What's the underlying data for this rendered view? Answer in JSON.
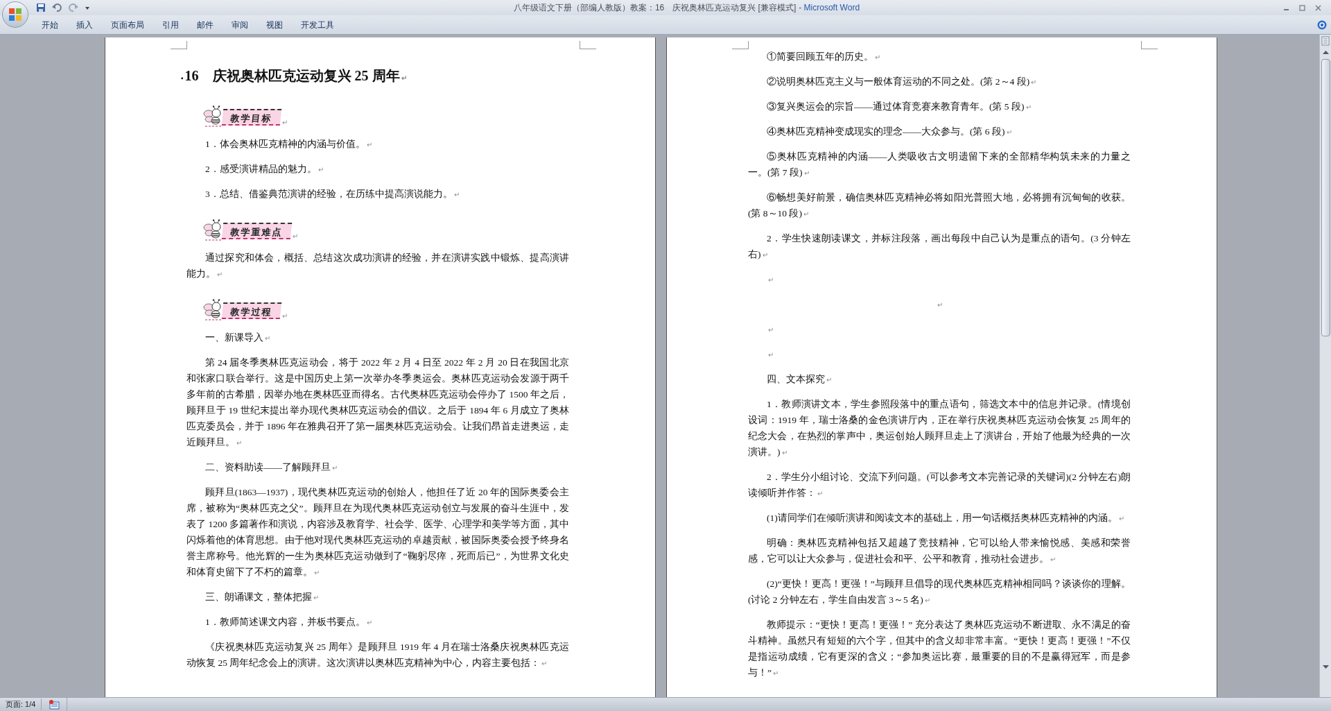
{
  "window": {
    "title": "八年级语文下册（部编人教版）教案：16　庆祝奥林匹克运动复兴 [兼容模式]",
    "app_name": "- Microsoft Word"
  },
  "ribbon_tabs": [
    {
      "label": "开始"
    },
    {
      "label": "插入"
    },
    {
      "label": "页面布局"
    },
    {
      "label": "引用"
    },
    {
      "label": "邮件"
    },
    {
      "label": "审阅"
    },
    {
      "label": "视图"
    },
    {
      "label": "开发工具"
    }
  ],
  "pages": [
    {
      "blocks": [
        {
          "kind": "title",
          "marker": "▪",
          "text": "16　庆祝奥林匹克运动复兴 25 周年",
          "mark": "↵"
        },
        {
          "kind": "badge",
          "text": "教学目标",
          "mark": "↵"
        },
        {
          "kind": "para",
          "text": "1．体会奥林匹克精神的内涵与价值。",
          "mark": "↵"
        },
        {
          "kind": "para",
          "text": "2．感受演讲精品的魅力。",
          "mark": "↵"
        },
        {
          "kind": "para",
          "text": "3．总结、借鉴典范演讲的经验，在历练中提高演说能力。",
          "mark": "↵"
        },
        {
          "kind": "badge",
          "text": "教学重难点",
          "mark": "↵"
        },
        {
          "kind": "para",
          "text": "通过探究和体会，概括、总结这次成功演讲的经验，并在演讲实践中锻炼、提高演讲能力。",
          "mark": "↵"
        },
        {
          "kind": "badge",
          "text": "教学过程",
          "mark": "↵"
        },
        {
          "kind": "para",
          "text": "一、新课导入",
          "mark": "↵"
        },
        {
          "kind": "para",
          "text": "第 24 届冬季奥林匹克运动会，将于 2022 年 2 月 4 日至 2022 年 2 月 20 日在我国北京和张家口联合举行。这是中国历史上第一次举办冬季奥运会。奥林匹克运动会发源于两千多年前的古希腊，因举办地在奥林匹亚而得名。古代奥林匹克运动会停办了 1500 年之后，顾拜旦于 19 世纪末提出举办现代奥林匹克运动会的倡议。之后于 1894 年 6 月成立了奥林匹克委员会，并于 1896 年在雅典召开了第一届奥林匹克运动会。让我们昂首走进奥运，走近顾拜旦。",
          "mark": "↵"
        },
        {
          "kind": "para",
          "text": "二、资料助读——了解顾拜旦",
          "mark": "↵"
        },
        {
          "kind": "para",
          "text": "顾拜旦(1863—1937)，现代奥林匹克运动的创始人，他担任了近 20 年的国际奥委会主席，被称为“奥林匹克之父”。顾拜旦在为现代奥林匹克运动创立与发展的奋斗生涯中，发表了 1200 多篇著作和演说，内容涉及教育学、社会学、医学、心理学和美学等方面，其中闪烁着他的体育思想。由于他对现代奥林匹克运动的卓越贡献，被国际奥委会授予终身名誉主席称号。他光辉的一生为奥林匹克运动做到了“鞠躬尽瘁，死而后已”，为世界文化史和体育史留下了不朽的篇章。",
          "mark": "↵"
        },
        {
          "kind": "para",
          "text": "三、朗诵课文，整体把握",
          "mark": "↵"
        },
        {
          "kind": "para",
          "text": "1．教师简述课文内容，并板书要点。",
          "mark": "↵"
        },
        {
          "kind": "para",
          "text": "《庆祝奥林匹克运动复兴 25 周年》是顾拜旦 1919 年 4 月在瑞士洛桑庆祝奥林匹克运动恢复 25 周年纪念会上的演讲。这次演讲以奥林匹克精神为中心，内容主要包括：",
          "mark": "↵"
        }
      ]
    },
    {
      "blocks": [
        {
          "kind": "para",
          "text": "①简要回顾五年的历史。",
          "mark": "↵"
        },
        {
          "kind": "para",
          "text": "②说明奥林匹克主义与一般体育运动的不同之处。(第 2～4 段)",
          "mark": "↵"
        },
        {
          "kind": "para",
          "text": "③复兴奥运会的宗旨——通过体育竞赛来教育青年。(第 5 段)",
          "mark": "↵"
        },
        {
          "kind": "para",
          "text": "④奥林匹克精神变成现实的理念——大众参与。(第 6 段)",
          "mark": "↵"
        },
        {
          "kind": "para",
          "text": "⑤奥林匹克精神的内涵——人类吸收古文明遗留下来的全部精华构筑未来的力量之一。(第 7 段)",
          "mark": "↵"
        },
        {
          "kind": "para",
          "text": "⑥畅想美好前景，确信奥林匹克精神必将如阳光普照大地，必将拥有沉甸甸的收获。(第 8～10 段)",
          "mark": "↵"
        },
        {
          "kind": "para",
          "text": "2．学生快速朗读课文，并标注段落，画出每段中自己认为是重点的语句。(3 分钟左右)",
          "mark": "↵"
        },
        {
          "kind": "blank",
          "mark": "↵"
        },
        {
          "kind": "centered",
          "mark": "↵"
        },
        {
          "kind": "blank",
          "mark": "↵"
        },
        {
          "kind": "blank",
          "mark": "↵"
        },
        {
          "kind": "para",
          "text": "四、文本探究",
          "mark": "↵"
        },
        {
          "kind": "para",
          "text": "1．教师演讲文本，学生参照段落中的重点语句，筛选文本中的信息并记录。(情境创设词：1919 年，瑞士洛桑的金色演讲厅内，正在举行庆祝奥林匹克运动会恢复 25 周年的纪念大会，在热烈的掌声中，奥运创始人顾拜旦走上了演讲台，开始了他最为经典的一次演讲。)",
          "mark": "↵"
        },
        {
          "kind": "para",
          "text": "2．学生分小组讨论、交流下列问题。(可以参考文本完善记录的关键词)(2 分钟左右)朗读倾听并作答：",
          "mark": "↵"
        },
        {
          "kind": "para",
          "text": "(1)请同学们在倾听演讲和阅读文本的基础上，用一句话概括奥林匹克精神的内涵。",
          "mark": "↵"
        },
        {
          "kind": "para",
          "text": "明确：奥林匹克精神包括又超越了竞技精神，它可以给人带来愉悦感、美感和荣誉感，它可以让大众参与，促进社会和平、公平和教育，推动社会进步。",
          "mark": "↵"
        },
        {
          "kind": "para",
          "text": "(2)“更快！更高！更强！”与顾拜旦倡导的现代奥林匹克精神相同吗？谈谈你的理解。(讨论 2 分钟左右，学生自由发言 3～5 名)",
          "mark": "↵"
        },
        {
          "kind": "para",
          "text": "教师提示：“更快！更高！更强！” 充分表达了奥林匹克运动不断进取、永不满足的奋斗精神。虽然只有短短的六个字，但其中的含义却非常丰富。“更快！更高！更强！”不仅是指运动成绩，它有更深的含义；“参加奥运比赛，最重要的目的不是赢得冠军，而是参与！”",
          "mark": "↵"
        }
      ]
    }
  ],
  "status_bar": {
    "page": "页面: 1/4"
  }
}
